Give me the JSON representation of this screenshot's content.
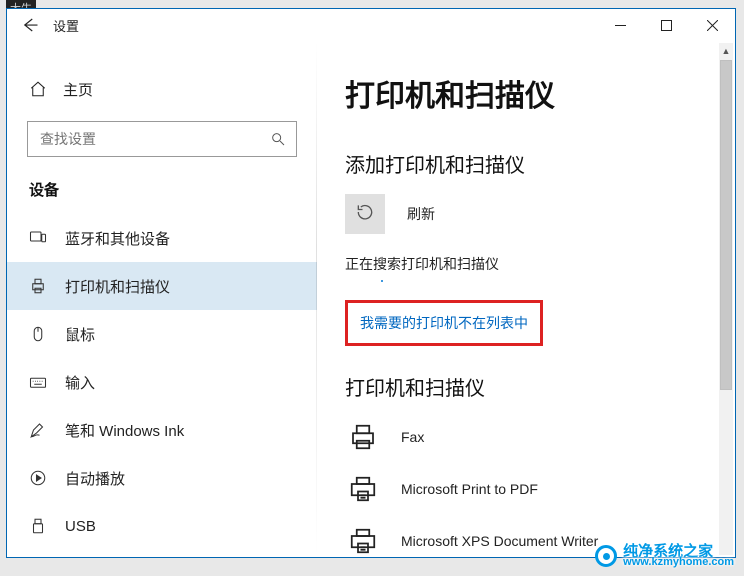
{
  "topLabel": "大牛",
  "titlebar": {
    "app_title": "设置"
  },
  "sidebar": {
    "home_label": "主页",
    "search_placeholder": "查找设置",
    "section_title": "设备",
    "items": [
      {
        "label": "蓝牙和其他设备"
      },
      {
        "label": "打印机和扫描仪"
      },
      {
        "label": "鼠标"
      },
      {
        "label": "输入"
      },
      {
        "label": "笔和 Windows Ink"
      },
      {
        "label": "自动播放"
      },
      {
        "label": "USB"
      }
    ]
  },
  "content": {
    "page_title": "打印机和扫描仪",
    "add_section_title": "添加打印机和扫描仪",
    "refresh_label": "刷新",
    "searching_text": "正在搜索打印机和扫描仪",
    "not_listed_link": "我需要的打印机不在列表中",
    "list_title": "打印机和扫描仪",
    "devices": [
      {
        "label": "Fax"
      },
      {
        "label": "Microsoft Print to PDF"
      },
      {
        "label": "Microsoft XPS Document Writer"
      }
    ]
  },
  "watermark": {
    "brand": "纯净系统之家",
    "url": "www.kzmyhome.com"
  }
}
